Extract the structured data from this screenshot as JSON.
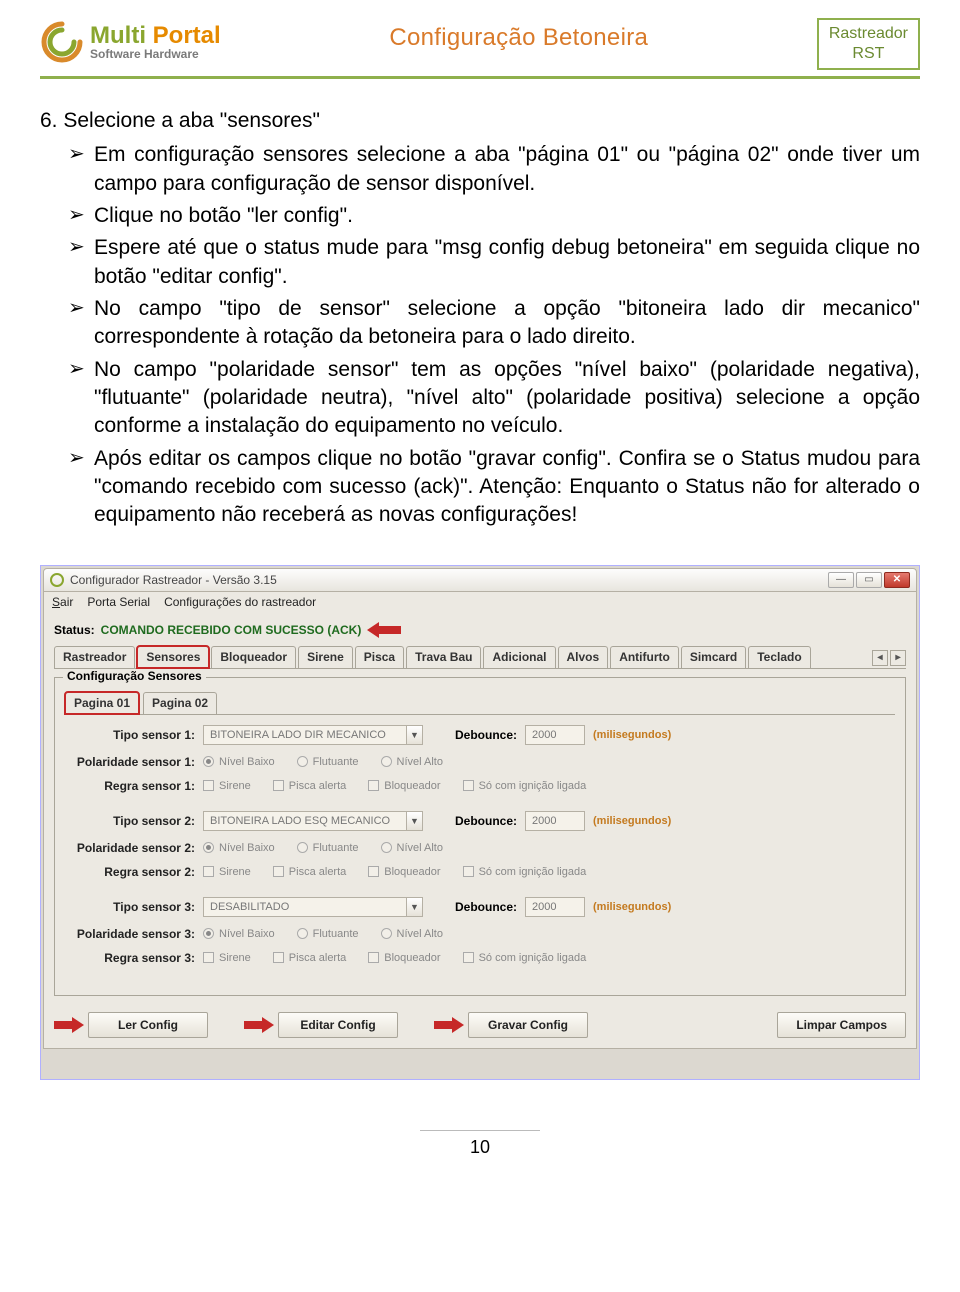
{
  "header": {
    "logo_line1_a": "Multi",
    "logo_line1_b": " Portal",
    "logo_line2": "Software Hardware",
    "title": "Configuração Betoneira",
    "badge_line1": "Rastreador",
    "badge_line2": "RST"
  },
  "section": {
    "number": "6. Selecione a aba \"sensores\"",
    "bullets": [
      "Em configuração sensores selecione a aba \"página 01\" ou \"página 02\" onde tiver um campo para configuração de sensor disponível.",
      "Clique no botão \"ler config\".",
      "Espere até que o status mude para \"msg config debug betoneira\" em seguida clique no botão \"editar config\".",
      "No campo \"tipo de sensor\" selecione a opção \"bitoneira lado dir mecanico\" correspondente à rotação da betoneira para o lado direito.",
      "No campo \"polaridade sensor\" tem as opções \"nível baixo\" (polaridade negativa), \"flutuante\" (polaridade neutra), \"nível alto\" (polaridade positiva) selecione a opção conforme a instalação do equipamento no veículo.",
      "Após editar os campos clique no botão \"gravar config\". Confira se o Status mudou para \"comando recebido com sucesso (ack)\". Atenção: Enquanto o Status não for alterado o equipamento não receberá as novas configurações!"
    ]
  },
  "app": {
    "title": "Configurador Rastreador - Versão 3.15",
    "menus": [
      "Sair",
      "Porta Serial",
      "Configurações do rastreador"
    ],
    "status_label": "Status:",
    "status_value": "COMANDO RECEBIDO COM SUCESSO (ACK)",
    "tabs": [
      "Rastreador",
      "Sensores",
      "Bloqueador",
      "Sirene",
      "Pisca",
      "Trava Bau",
      "Adicional",
      "Alvos",
      "Antifurto",
      "Simcard",
      "Teclado"
    ],
    "groupbox_title": "Configuração Sensores",
    "subtabs": [
      "Pagina 01",
      "Pagina 02"
    ],
    "labels": {
      "tipo": "Tipo sensor",
      "polaridade": "Polaridade sensor",
      "regra": "Regra sensor",
      "debounce": "Debounce:",
      "unit": "(milisegundos)"
    },
    "polarity_options": [
      "Nível Baixo",
      "Flutuante",
      "Nível Alto"
    ],
    "rule_options": [
      "Sirene",
      "Pisca alerta",
      "Bloqueador",
      "Só com ignição ligada"
    ],
    "sensors": [
      {
        "n": "1",
        "type": "BITONEIRA LADO DIR MECANICO",
        "debounce": "2000"
      },
      {
        "n": "2",
        "type": "BITONEIRA LADO ESQ MECANICO",
        "debounce": "2000"
      },
      {
        "n": "3",
        "type": "DESABILITADO",
        "debounce": "2000"
      }
    ],
    "buttons": [
      "Ler Config",
      "Editar Config",
      "Gravar Config",
      "Limpar Campos"
    ]
  },
  "page_number": "10"
}
